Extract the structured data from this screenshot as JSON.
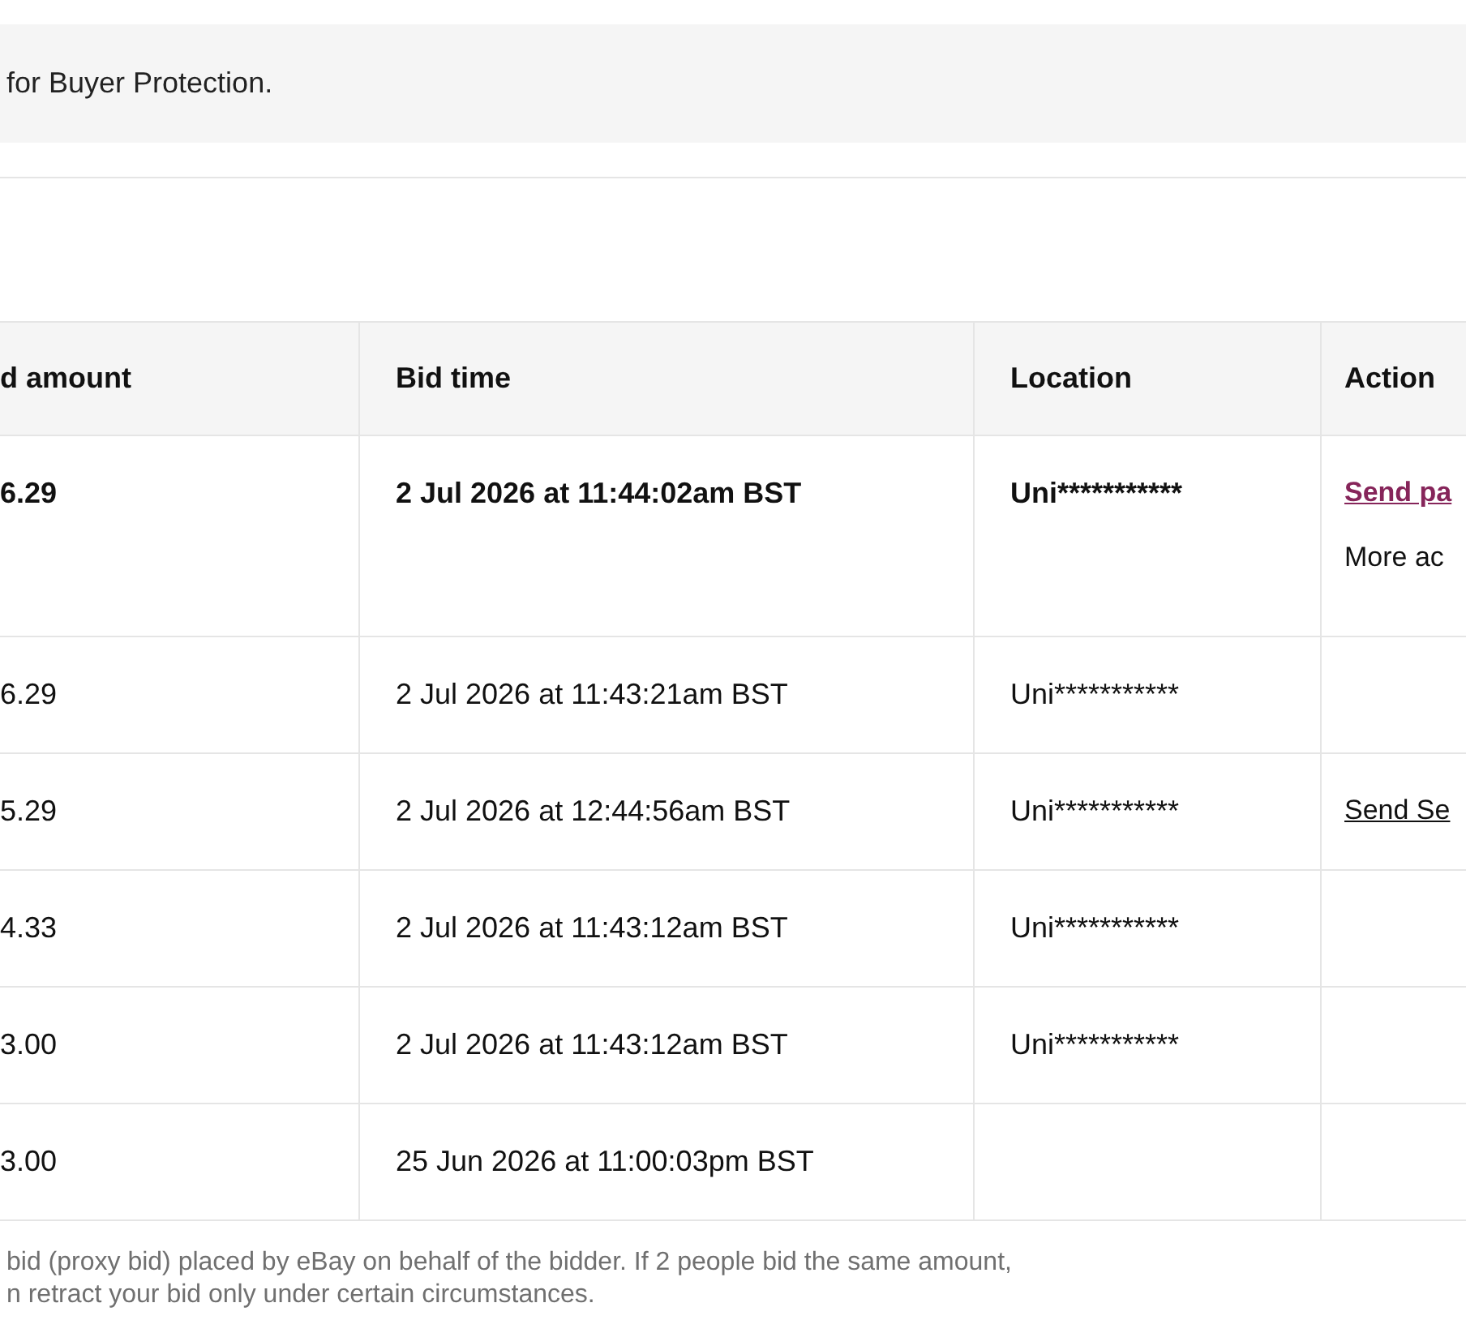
{
  "notice": {
    "text": "for Buyer Protection."
  },
  "table": {
    "columns": [
      "d amount",
      "Bid time",
      "Location",
      "Action"
    ],
    "rows": [
      {
        "amount": "6.29",
        "time": "2 Jul 2026 at 11:44:02am BST",
        "location": "Uni***********",
        "highlighted": true,
        "actions": [
          {
            "kind": "primary",
            "text": "Send pa"
          },
          {
            "kind": "menu",
            "text": "More ac"
          }
        ]
      },
      {
        "amount": "6.29",
        "time": "2 Jul 2026 at 11:43:21am BST",
        "location": "Uni***********",
        "highlighted": false,
        "actions": []
      },
      {
        "amount": "5.29",
        "time": "2 Jul 2026 at 12:44:56am BST",
        "location": "Uni***********",
        "highlighted": false,
        "actions": [
          {
            "kind": "link",
            "text": "Send Se"
          }
        ]
      },
      {
        "amount": "4.33",
        "time": "2 Jul 2026 at 11:43:12am BST",
        "location": "Uni***********",
        "highlighted": false,
        "actions": []
      },
      {
        "amount": "3.00",
        "time": "2 Jul 2026 at 11:43:12am BST",
        "location": "Uni***********",
        "highlighted": false,
        "actions": []
      },
      {
        "amount": "3.00",
        "time": "25 Jun 2026 at 11:00:03pm BST",
        "highlighted": false,
        "actions": []
      }
    ]
  },
  "footnotes": [
    "bid (proxy bid) placed by eBay on behalf of the bidder. If 2 people bid the same amount,",
    "n retract your bid only under certain circumstances."
  ]
}
